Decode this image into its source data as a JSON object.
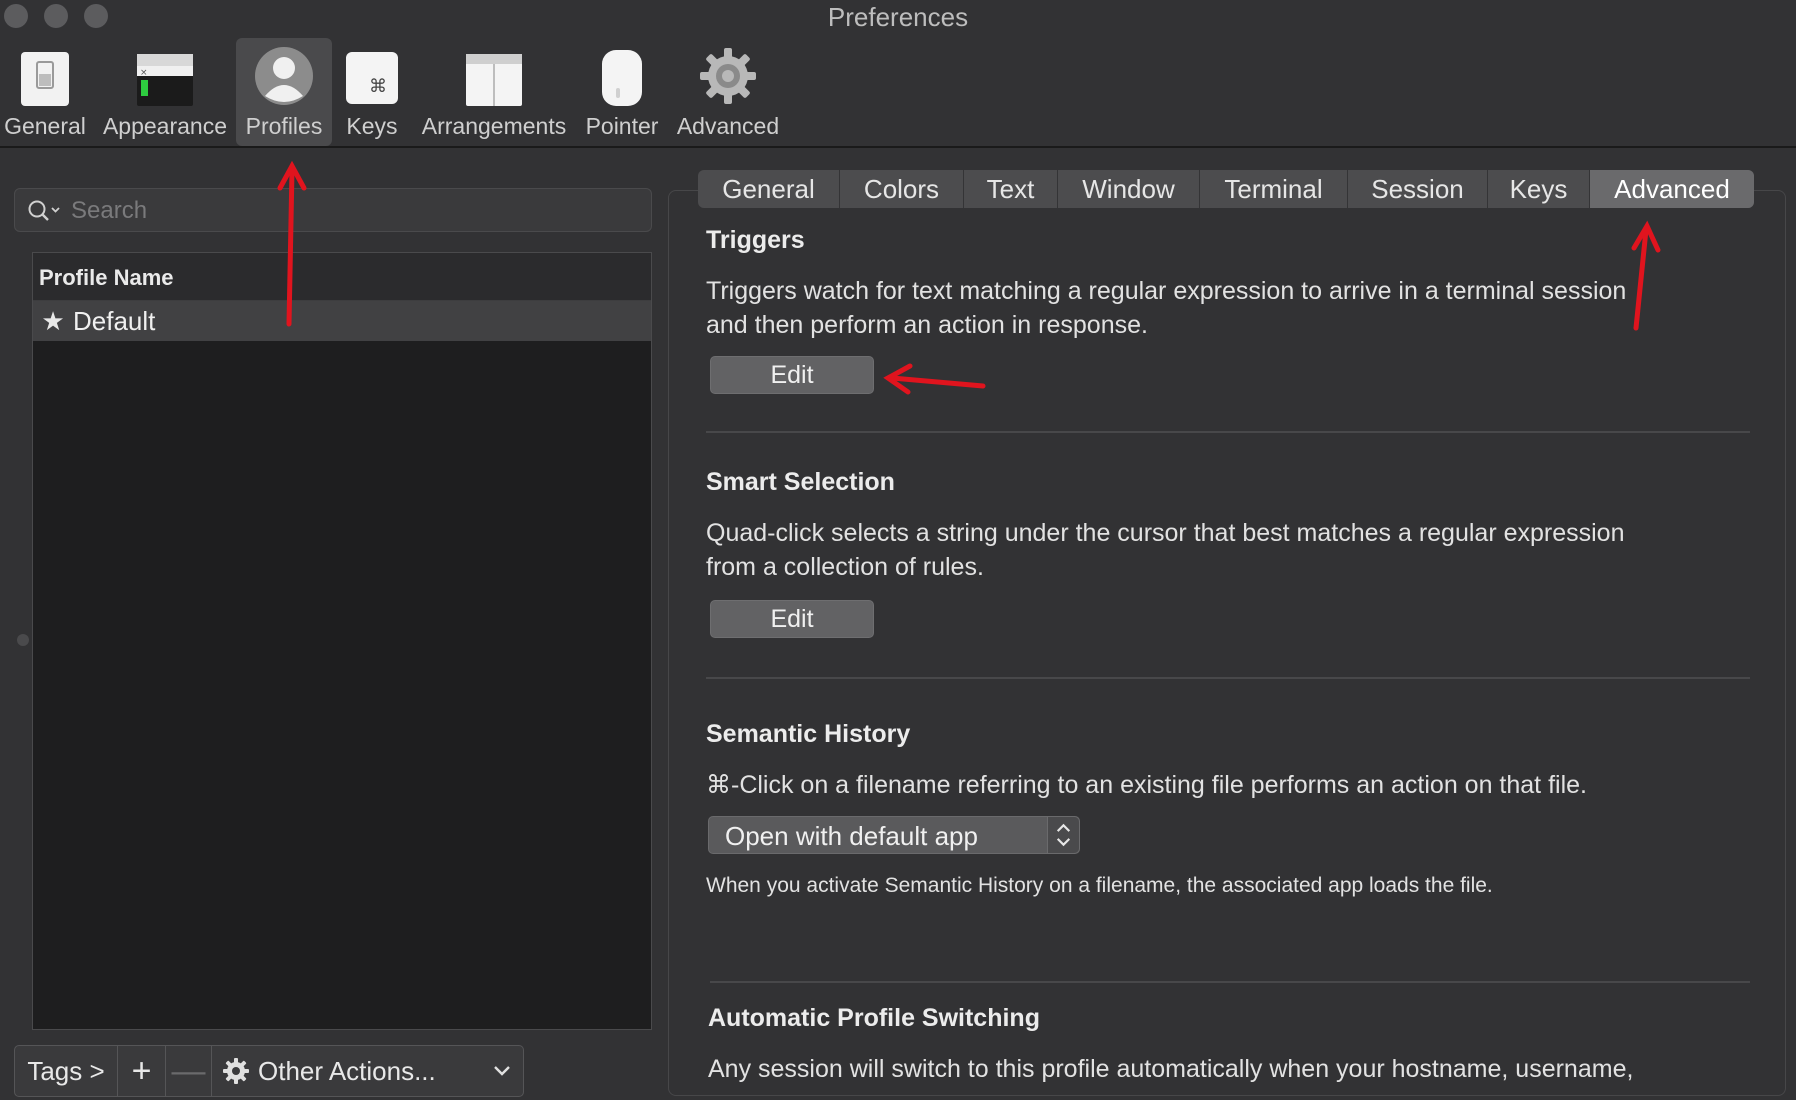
{
  "window": {
    "title": "Preferences"
  },
  "toolbar": {
    "items": [
      {
        "label": "General",
        "icon": "general-switch-icon"
      },
      {
        "label": "Appearance",
        "icon": "appearance-window-icon"
      },
      {
        "label": "Profiles",
        "icon": "profile-person-icon",
        "selected": true
      },
      {
        "label": "Keys",
        "icon": "command-key-icon"
      },
      {
        "label": "Arrangements",
        "icon": "arrangements-window-icon"
      },
      {
        "label": "Pointer",
        "icon": "mouse-icon"
      },
      {
        "label": "Advanced",
        "icon": "gear-icon"
      }
    ]
  },
  "profiles_pane": {
    "search": {
      "placeholder": "Search",
      "value": ""
    },
    "column_header": "Profile Name",
    "profiles": [
      {
        "name": "Default",
        "icon": "star-icon",
        "selected": true
      }
    ],
    "bottom_bar": {
      "tags": "Tags >",
      "add": "+",
      "remove": "—",
      "other_actions": "Other Actions..."
    }
  },
  "settings_pane": {
    "tabs": [
      {
        "label": "General"
      },
      {
        "label": "Colors"
      },
      {
        "label": "Text"
      },
      {
        "label": "Window"
      },
      {
        "label": "Terminal"
      },
      {
        "label": "Session"
      },
      {
        "label": "Keys"
      },
      {
        "label": "Advanced",
        "selected": true
      }
    ],
    "triggers": {
      "title": "Triggers",
      "description_line1": "Triggers watch for text matching a regular expression to arrive in a terminal session",
      "description_line2": "and then perform an action in response.",
      "button": "Edit"
    },
    "smart_selection": {
      "title": "Smart Selection",
      "description_line1": "Quad-click selects a string under the cursor that best matches a regular expression",
      "description_line2": "from a collection of rules.",
      "button": "Edit"
    },
    "semantic_history": {
      "title": "Semantic History",
      "description": "⌘-Click on a filename referring to an existing file performs an action on that file.",
      "select_value": "Open with default app",
      "note": "When you activate Semantic History on a filename, the associated app loads the file."
    },
    "automatic_profile_switching": {
      "title": "Automatic Profile Switching",
      "description": "Any session will switch to this profile automatically when your hostname, username,"
    }
  },
  "colors": {
    "annotation_arrow": "#e0141e",
    "window_bg": "#323234",
    "selected_tab": "#6a6a6c"
  }
}
